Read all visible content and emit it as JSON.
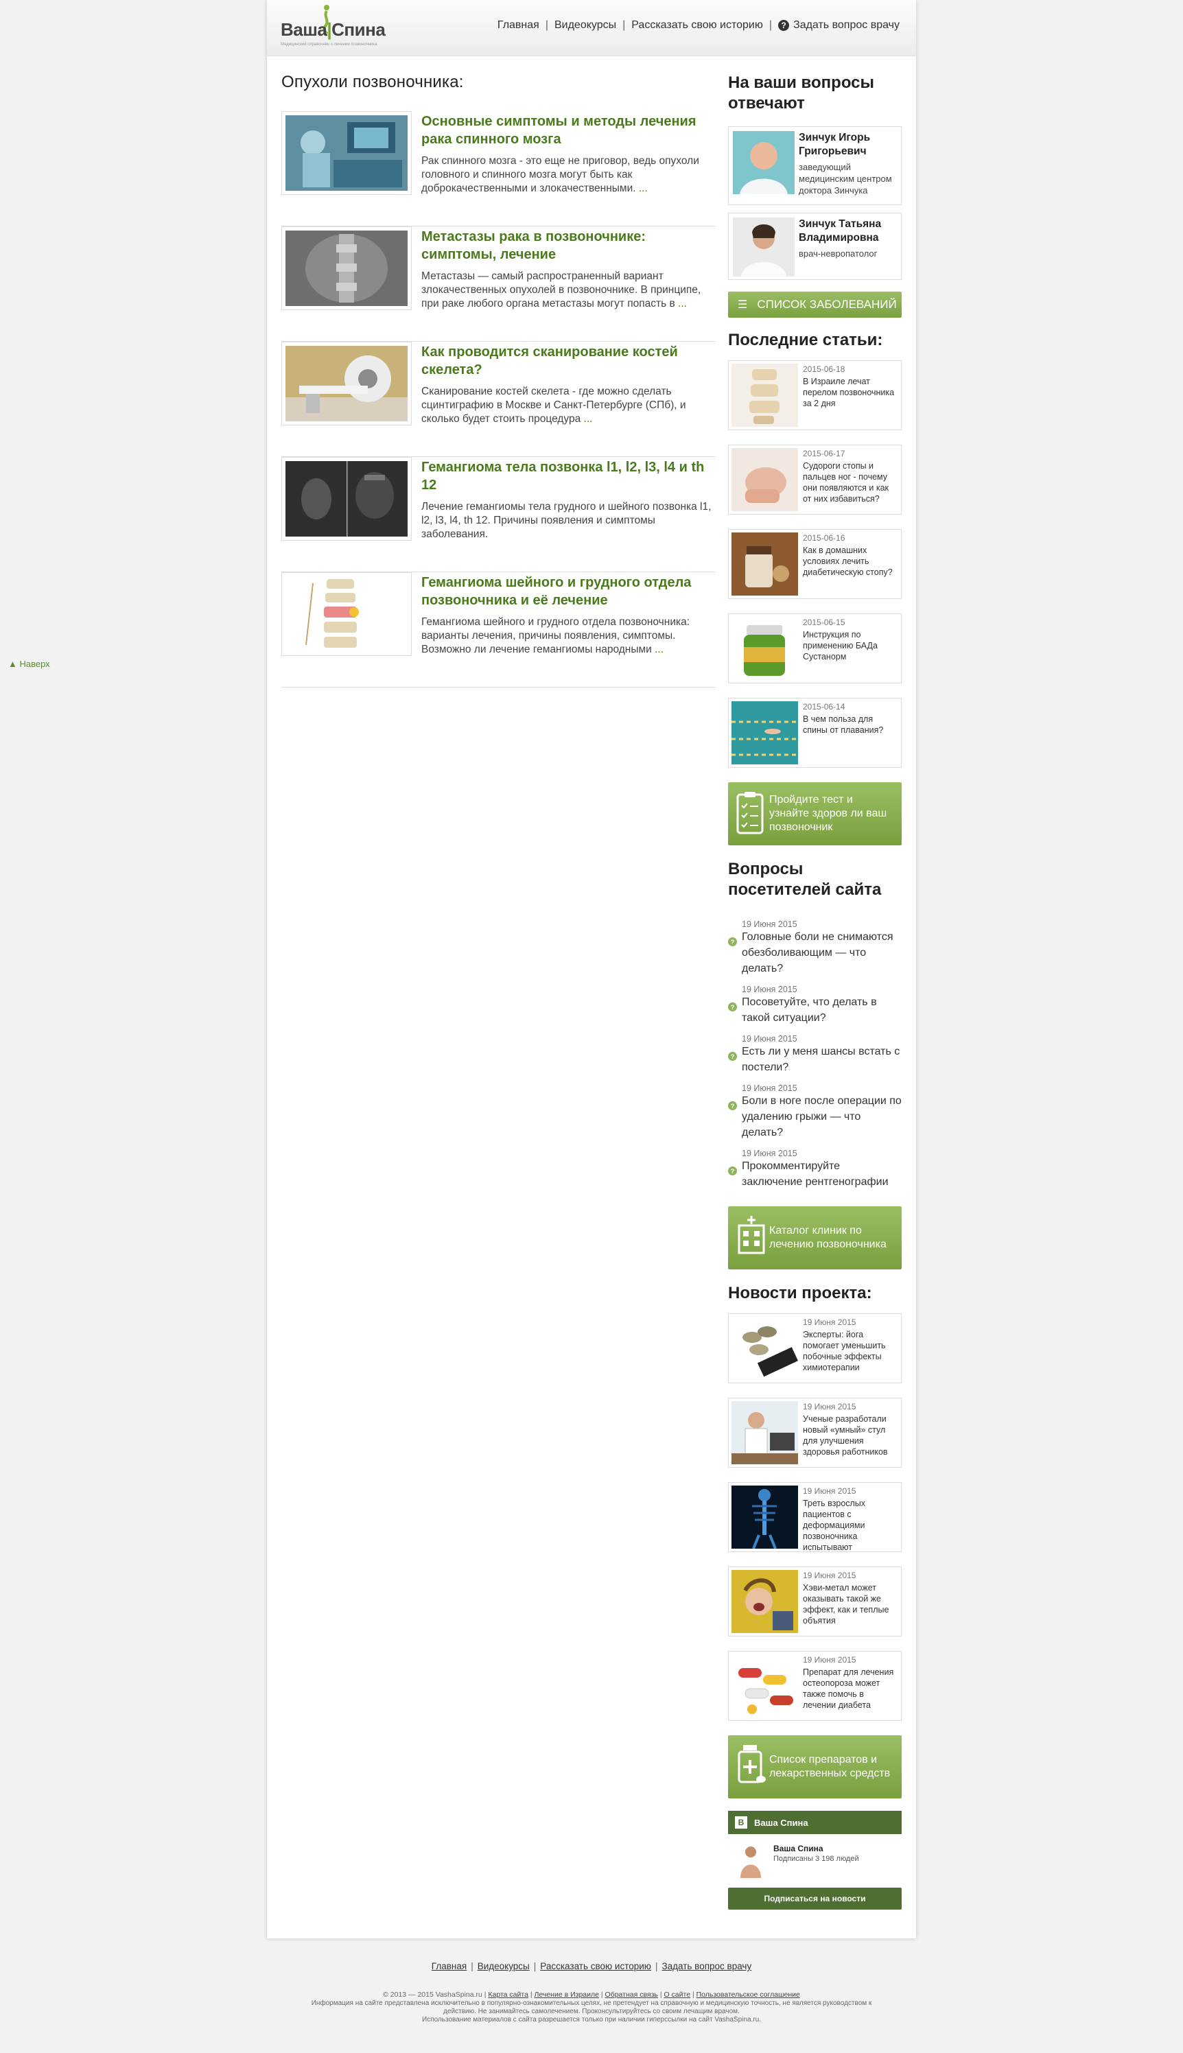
{
  "to_top": "▲ Наверх",
  "header": {
    "logo_left": "Ваша",
    "logo_right": "Спина",
    "logo_sub": "Медицинский справочник о лечении позвоночника",
    "nav": [
      "Главная",
      "Видеокурсы",
      "Рассказать свою историю"
    ],
    "ask": "Задать вопрос врачу"
  },
  "main": {
    "title": "Опухоли позвоночника:",
    "articles": [
      {
        "title": "Основные симптомы и методы лечения рака спинного мозга",
        "text": "Рак спинного мозга - это еще не приговор, ведь опухоли головного и спинного мозга могут быть как доброкачественными и злокачественными.",
        "more": "..."
      },
      {
        "title": "Метастазы рака в позвоночнике: симптомы, лечение",
        "text": "Метастазы — самый распространенный вариант злокачественных опухолей в позвоночнике. В принципе, при раке любого органа метастазы могут попасть в",
        "more": "..."
      },
      {
        "title": "Как проводится сканирование костей скелета?",
        "text": "Сканирование костей скелета - где можно сделать сцинтиграфию в Москве и Санкт-Петербурге (СПб), и сколько будет стоить процедура",
        "more": "..."
      },
      {
        "title": "Гемангиома тела позвонка l1, l2, l3, l4 и th 12",
        "text": "Лечение гемангиомы тела грудного и шейного позвонка l1, l2, l3, l4, th 12. Причины появления и симптомы заболевания.",
        "more": ""
      },
      {
        "title": "Гемангиома шейного и грудного отдела позвоночника и её лечение",
        "text": "Гемангиома шейного и грудного отдела позвоночника: варианты лечения, причины появления, симптомы. Возможно ли лечение гемангиомы народными",
        "more": "..."
      }
    ]
  },
  "sidebar": {
    "doctors_title": "На ваши вопросы отвечают",
    "doctors": [
      {
        "name": "Зинчук Игорь Григорьевич",
        "role": "заведующий медицинским центром доктора Зинчука"
      },
      {
        "name": "Зинчук Татьяна Владимировна",
        "role": "врач-невропатолог"
      }
    ],
    "diseases_button": "СПИСОК ЗАБОЛЕВАНИЙ",
    "latest_title": "Последние статьи:",
    "latest": [
      {
        "date": "2015-06-18",
        "text": "В Израиле лечат перелом позвоночника за 2 дня"
      },
      {
        "date": "2015-06-17",
        "text": "Судороги стопы и пальцев ног - почему они появляются и как от них избавиться?"
      },
      {
        "date": "2015-06-16",
        "text": "Как в домашних условиях лечить диабетическую стопу?"
      },
      {
        "date": "2015-06-15",
        "text": "Инструкция по применению БАДа Сустанорм"
      },
      {
        "date": "2015-06-14",
        "text": "В чем польза для спины от плавания?"
      }
    ],
    "test_promo": "Пройдите тест и узнайте здоров ли ваш позвоночник",
    "questions_title": "Вопросы посетителей сайта",
    "questions": [
      {
        "date": "19 Июня 2015",
        "text": "Головные боли не снимаются обезболивающим — что делать?"
      },
      {
        "date": "19 Июня 2015",
        "text": "Посоветуйте, что делать в такой ситуации?"
      },
      {
        "date": "19 Июня 2015",
        "text": "Есть ли у меня шансы встать с постели?"
      },
      {
        "date": "19 Июня 2015",
        "text": "Боли в ноге после операции по удалению грыжи — что делать?"
      },
      {
        "date": "19 Июня 2015",
        "text": "Прокомментируйте заключение рентгенографии"
      }
    ],
    "clinics_promo": "Каталог клиник по лечению позвоночника",
    "news_title": "Новости проекта:",
    "news": [
      {
        "date": "19 Июня 2015",
        "text": "Эксперты: йога помогает уменьшить побочные эффекты химиотерапии"
      },
      {
        "date": "19 Июня 2015",
        "text": "Ученые разработали новый «умный» стул для улучшения здоровья работников"
      },
      {
        "date": "19 Июня 2015",
        "text": "Треть взрослых пациентов с деформациями позвоночника испытывают"
      },
      {
        "date": "19 Июня 2015",
        "text": "Хэви-метал может оказывать такой же эффект, как и теплые объятия"
      },
      {
        "date": "19 Июня 2015",
        "text": "Препарат для лечения остеопороза может также помочь в лечении диабета"
      }
    ],
    "drugs_promo": "Список препаратов и лекарственных средств",
    "vk": {
      "title": "Ваша Спина",
      "name": "Ваша Спина",
      "subs": "Подписаны 3 198 людей",
      "button": "Подписаться на новости",
      "logo": "В"
    }
  },
  "footer": {
    "nav": [
      "Главная",
      "Видеокурсы",
      "Рассказать свою историю",
      "Задать вопрос врачу"
    ],
    "copyright": "© 2013 — 2015 VashaSpina.ru",
    "links": [
      "Карта сайта",
      "Лечение в Израиле",
      "Обратная связь",
      "О сайте",
      "Пользовательское соглашение"
    ],
    "disclaimer1": "Информация на сайте представлена исключительно в популярно-ознакомительных целях, не претендует на справочную и медицинскую точность, не является руководством к",
    "disclaimer2": "действию. Не занимайтесь самолечением. Проконсультируйтесь со своим лечащим врачом.",
    "disclaimer3": "Использование материалов с сайта разрешается только при наличии гиперссылки на сайт VashaSpina.ru."
  }
}
